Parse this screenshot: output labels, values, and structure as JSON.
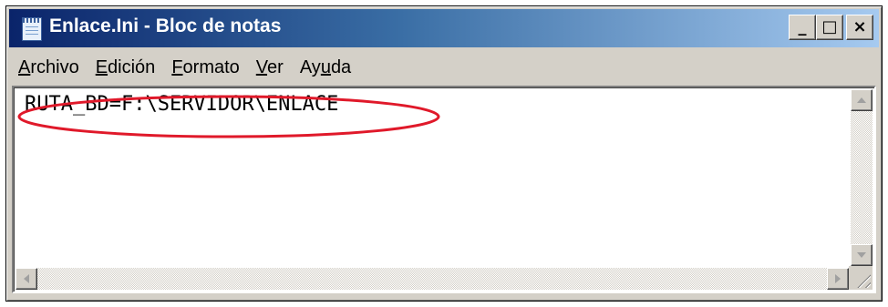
{
  "window": {
    "title": "Enlace.Ini - Bloc de notas",
    "controls": {
      "minimize": "_",
      "maximize": "□",
      "close": "×"
    }
  },
  "menu": [
    {
      "pre": "",
      "ul": "A",
      "post": "rchivo"
    },
    {
      "pre": "",
      "ul": "E",
      "post": "dición"
    },
    {
      "pre": "",
      "ul": "F",
      "post": "ormato"
    },
    {
      "pre": "",
      "ul": "V",
      "post": "er"
    },
    {
      "pre": "Ay",
      "ul": "u",
      "post": "da"
    }
  ],
  "editor": {
    "content": "RUTA_BD=F:\\SERVIDOR\\ENLACE"
  },
  "icons": {
    "app": "notepad-icon",
    "annotation": "red-ellipse-highlight"
  },
  "colors": {
    "titlebar_start": "#0a246a",
    "titlebar_end": "#a6caf0",
    "annotation": "#e0192a"
  }
}
